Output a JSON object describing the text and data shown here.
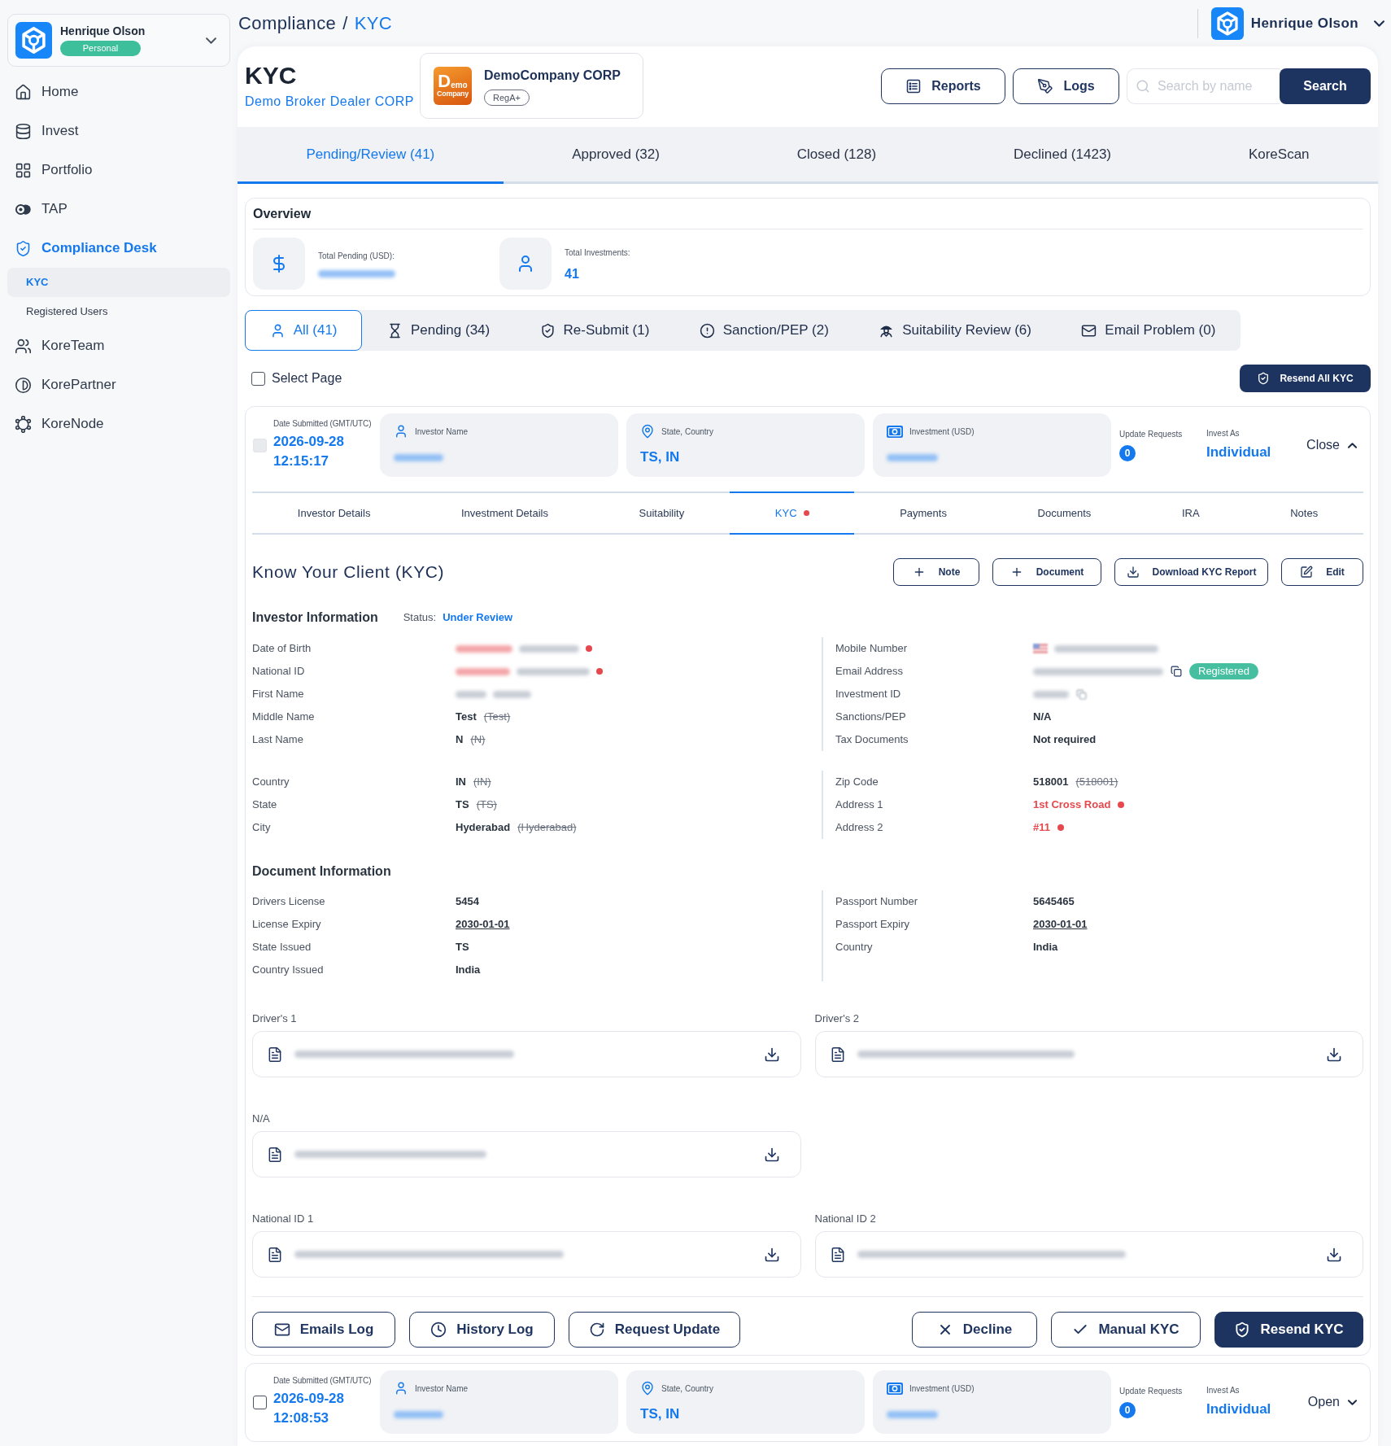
{
  "sidebar": {
    "profile": {
      "name": "Henrique Olson",
      "badge": "Personal"
    },
    "nav": [
      {
        "label": "Home",
        "selected": false
      },
      {
        "label": "Invest",
        "selected": false
      },
      {
        "label": "Portfolio",
        "selected": false
      },
      {
        "label": "TAP",
        "selected": false
      },
      {
        "label": "Compliance Desk",
        "selected": true,
        "children": [
          {
            "label": "KYC",
            "selected": true
          },
          {
            "label": "Registered Users",
            "selected": false
          }
        ]
      },
      {
        "label": "KoreTeam",
        "selected": false
      },
      {
        "label": "KorePartner",
        "selected": false
      },
      {
        "label": "KoreNode",
        "selected": false
      }
    ]
  },
  "breadcrumb": {
    "section": "Compliance",
    "separator": "/",
    "current": "KYC"
  },
  "user_menu": {
    "name": "Henrique Olson"
  },
  "header": {
    "title": "KYC",
    "subtitle": "Demo Broker Dealer CORP",
    "company": {
      "logo_initial": "D",
      "logo_rest": "emo",
      "logo_caption": "Company",
      "name": "DemoCompany CORP",
      "badge": "RegA+"
    },
    "buttons": [
      "Reports",
      "Logs"
    ],
    "search": {
      "placeholder": "Search by name",
      "button": "Search"
    }
  },
  "status_tabs": [
    {
      "label": "Pending/Review (41)",
      "selected": true
    },
    {
      "label": "Approved (32)",
      "selected": false
    },
    {
      "label": "Closed (128)",
      "selected": false
    },
    {
      "label": "Declined (1423)",
      "selected": false
    },
    {
      "label": "KoreScan",
      "selected": false
    }
  ],
  "overview": {
    "title": "Overview",
    "stats": [
      {
        "label": "Total Pending (USD):",
        "redacted": true
      },
      {
        "label": "Total Investments:",
        "redacted": false,
        "value": "41"
      }
    ]
  },
  "filters": [
    {
      "label": "All (41)",
      "selected": true
    },
    {
      "label": "Pending (34)",
      "selected": false
    },
    {
      "label": "Re-Submit (1)",
      "selected": false
    },
    {
      "label": "Sanction/PEP (2)",
      "selected": false
    },
    {
      "label": "Suitability Review (6)",
      "selected": false
    },
    {
      "label": "Email Problem (0)",
      "selected": false
    }
  ],
  "select_page": {
    "label": "Select Page",
    "checked": false
  },
  "resend_all_button": "Resend All KYC",
  "records": [
    {
      "date_label": "Date Submitted (GMT/UTC)",
      "date": "2026-09-28",
      "time": "12:15:17",
      "checked": false,
      "disabled": true,
      "fields": [
        {
          "label": "Investor Name",
          "redacted": true
        },
        {
          "label": "State, Country",
          "redacted": false,
          "value": "TS, IN"
        },
        {
          "label": "Investment (USD)",
          "redacted": true
        }
      ],
      "update_requests_label": "Update Requests",
      "update_requests": "0",
      "invest_as_label": "Invest As",
      "invest_as": "Individual",
      "toggle": "Close",
      "expanded": true,
      "detail": {
        "tabs": [
          {
            "label": "Investor Details",
            "selected": false,
            "alert": false
          },
          {
            "label": "Investment Details",
            "selected": false,
            "alert": false
          },
          {
            "label": "Suitability",
            "selected": false,
            "alert": false
          },
          {
            "label": "KYC",
            "selected": true,
            "alert": true
          },
          {
            "label": "Payments",
            "selected": false,
            "alert": false
          },
          {
            "label": "Documents",
            "selected": false,
            "alert": false
          },
          {
            "label": "IRA",
            "selected": false,
            "alert": false
          },
          {
            "label": "Notes",
            "selected": false,
            "alert": false
          }
        ],
        "title": "Know Your Client (KYC)",
        "actions": [
          "Note",
          "Document",
          "Download KYC Report",
          "Edit"
        ],
        "sections": [
          {
            "title": "Investor Information",
            "status_label": "Status:",
            "status": "Under Review",
            "groups": [
              {
                "left": [
                  {
                    "label": "Date of Birth",
                    "kind": "redacted",
                    "changed": true
                  },
                  {
                    "label": "National ID",
                    "kind": "redacted",
                    "changed": true
                  },
                  {
                    "label": "First Name",
                    "kind": "redacted",
                    "changed": false
                  },
                  {
                    "label": "Middle Name",
                    "kind": "text",
                    "value": "Test",
                    "previous": "(Test)",
                    "changed": false
                  },
                  {
                    "label": "Last Name",
                    "kind": "text",
                    "value": "N",
                    "previous": "(N)",
                    "changed": false
                  }
                ],
                "right": [
                  {
                    "label": "Mobile Number",
                    "kind": "phone"
                  },
                  {
                    "label": "Email Address",
                    "kind": "email",
                    "badge": "Registered"
                  },
                  {
                    "label": "Investment ID",
                    "kind": "copyable"
                  },
                  {
                    "label": "Sanctions/PEP",
                    "kind": "text",
                    "value": "N/A",
                    "changed": false
                  },
                  {
                    "label": "Tax Documents",
                    "kind": "text",
                    "value": "Not required",
                    "changed": false
                  }
                ]
              },
              {
                "left": [
                  {
                    "label": "Country",
                    "kind": "text",
                    "value": "IN",
                    "previous": "(IN)",
                    "changed": false
                  },
                  {
                    "label": "State",
                    "kind": "text",
                    "value": "TS",
                    "previous": "(TS)",
                    "changed": false
                  },
                  {
                    "label": "City",
                    "kind": "text",
                    "value": "Hyderabad",
                    "previous": "(Hyderabad)",
                    "changed": false
                  }
                ],
                "right": [
                  {
                    "label": "Zip Code",
                    "kind": "text",
                    "value": "518001",
                    "previous": "(518001)",
                    "changed": false
                  },
                  {
                    "label": "Address 1",
                    "kind": "text",
                    "value": "1st Cross Road",
                    "changed": true
                  },
                  {
                    "label": "Address 2",
                    "kind": "text",
                    "value": "#11",
                    "changed": true
                  }
                ]
              }
            ]
          },
          {
            "title": "Document Information",
            "groups": [
              {
                "left": [
                  {
                    "label": "Drivers License",
                    "kind": "text",
                    "value": "5454",
                    "changed": false
                  },
                  {
                    "label": "License Expiry",
                    "kind": "date",
                    "value": "2030-01-01",
                    "changed": false
                  },
                  {
                    "label": "State Issued",
                    "kind": "text",
                    "value": "TS",
                    "changed": false
                  },
                  {
                    "label": "Country Issued",
                    "kind": "text",
                    "value": "India",
                    "changed": false
                  }
                ],
                "right": [
                  {
                    "label": "Passport Number",
                    "kind": "text",
                    "value": "5645465",
                    "changed": false
                  },
                  {
                    "label": "Passport Expiry",
                    "kind": "date",
                    "value": "2030-01-01",
                    "changed": false
                  },
                  {
                    "label": "Country",
                    "kind": "text",
                    "value": "India",
                    "changed": false
                  }
                ]
              }
            ]
          }
        ],
        "file_rows": [
          [
            {
              "label": "Driver's 1"
            },
            {
              "label": "Driver's 2"
            }
          ],
          [
            {
              "label": "N/A"
            }
          ],
          [
            {
              "label": "National ID 1"
            },
            {
              "label": "National ID 2"
            }
          ]
        ],
        "footer_left": [
          "Emails Log",
          "History Log",
          "Request Update"
        ],
        "footer_right": [
          {
            "label": "Decline",
            "primary": false
          },
          {
            "label": "Manual KYC",
            "primary": false
          },
          {
            "label": "Resend KYC",
            "primary": true
          }
        ]
      }
    },
    {
      "date_label": "Date Submitted (GMT/UTC)",
      "date": "2026-09-28",
      "time": "12:08:53",
      "checked": false,
      "disabled": false,
      "fields": [
        {
          "label": "Investor Name",
          "redacted": true
        },
        {
          "label": "State, Country",
          "redacted": false,
          "value": "TS, IN"
        },
        {
          "label": "Investment (USD)",
          "redacted": true
        }
      ],
      "update_requests_label": "Update Requests",
      "update_requests": "0",
      "invest_as_label": "Invest As",
      "invest_as": "Individual",
      "toggle": "Open",
      "expanded": false
    }
  ]
}
